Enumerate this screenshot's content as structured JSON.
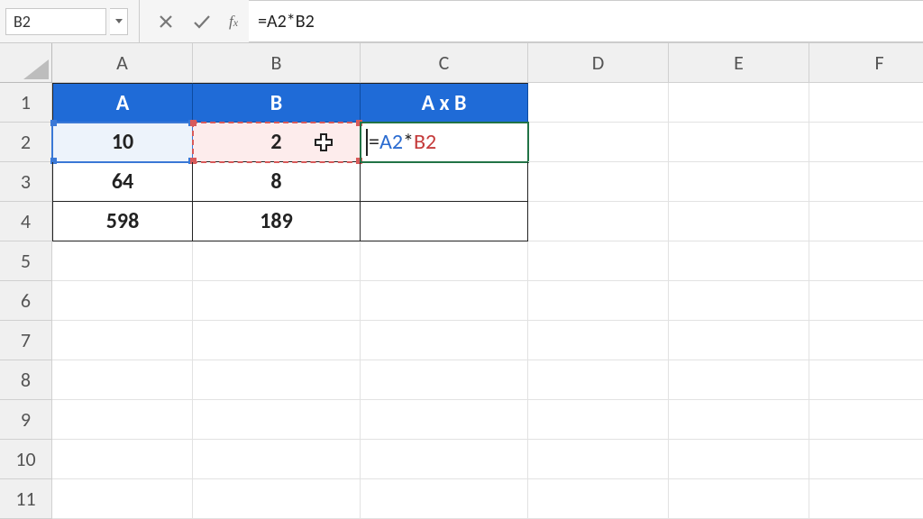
{
  "name_box": "B2",
  "formula_bar": "=A2*B2",
  "formula_tokens": {
    "eq": "=",
    "a": "A2",
    "op": "*",
    "b": "B2"
  },
  "columns": [
    "A",
    "B",
    "C",
    "D",
    "E",
    "F"
  ],
  "rows": [
    "1",
    "2",
    "3",
    "4",
    "5",
    "6",
    "7",
    "8",
    "9",
    "10",
    "11"
  ],
  "headers": {
    "a": "A",
    "b": "B",
    "c": "A x B"
  },
  "data": {
    "a2": "10",
    "b2": "2",
    "a3": "64",
    "b3": "8",
    "a4": "598",
    "b4": "189"
  },
  "editing_cell": "C2"
}
